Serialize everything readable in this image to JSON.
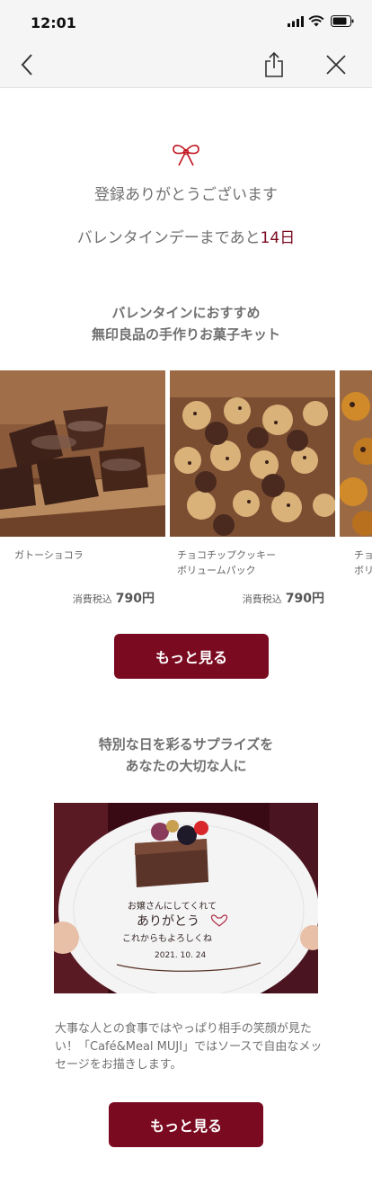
{
  "status_bar": {
    "time": "12:01"
  },
  "nav": {
    "back_icon": "chevron-left-icon",
    "share_icon": "share-icon",
    "close_icon": "close-icon"
  },
  "intro": {
    "bow_icon": "ribbon-bow-icon",
    "thanks_text": "登録ありがとうございます",
    "countdown_prefix": "バレンタインデーまであと",
    "countdown_days": "14日"
  },
  "recommend": {
    "heading_line1": "バレンタインにおすすめ",
    "heading_line2": "無印良品の手作りお菓子キット",
    "products": [
      {
        "name_line1": "ガトーショコラ",
        "name_line2": "",
        "price_label": "消費税込",
        "price": "790円"
      },
      {
        "name_line1": "チョコチップクッキー",
        "name_line2": "ボリュームパック",
        "price_label": "消費税込",
        "price": "790円"
      },
      {
        "name_line1": "チョ",
        "name_line2": "ボリ",
        "price_label": "",
        "price": ""
      }
    ],
    "more_button": "もっと見る"
  },
  "surprise": {
    "heading_line1": "特別な日を彩るサプライズを",
    "heading_line2": "あなたの大切な人に",
    "plate_line1": "お嬢さんにしてくれて",
    "plate_line2": "ありがとう",
    "plate_line3": "これからもよろしくね",
    "plate_date": "2021. 10. 24",
    "description": "大事な人との食事ではやっぱり相手の笑顔が見たい！「Café&Meal MUJI」ではソースで自由なメッセージをお描きします。",
    "more_button": "もっと見る"
  },
  "colors": {
    "accent": "#7a0a1f",
    "text_gray": "#707070",
    "bar_bg": "#f5f5f5"
  }
}
